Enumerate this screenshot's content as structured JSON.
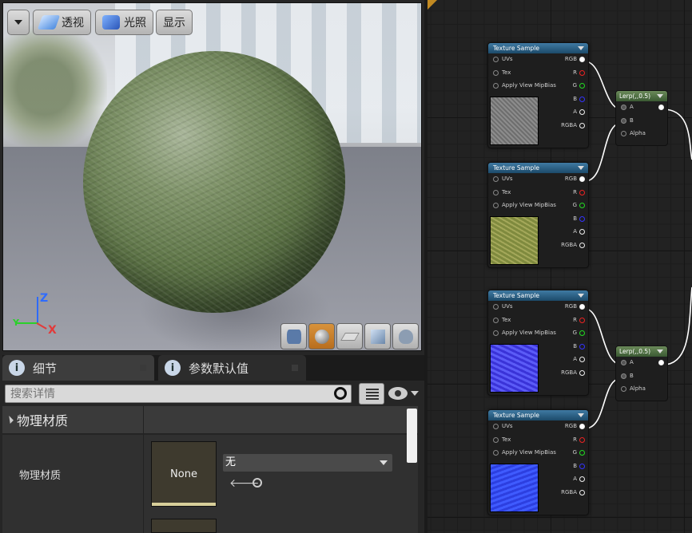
{
  "viewport": {
    "toolbar": {
      "perspective_label": "透视",
      "lighting_label": "光照",
      "show_label": "显示"
    },
    "axes": {
      "z": "Z",
      "y": "Y",
      "x": "X"
    },
    "preview_shapes": [
      "cylinder-icon",
      "sphere-icon",
      "plane-icon",
      "cube-icon",
      "teapot-icon"
    ],
    "active_shape": "sphere-icon"
  },
  "details": {
    "tabs": [
      {
        "label": "细节",
        "icon": "info-icon"
      },
      {
        "label": "参数默认值",
        "icon": "info-icon"
      }
    ],
    "search": {
      "placeholder": "搜索详情"
    },
    "section_title": "物理材质",
    "property_label": "物理材质",
    "thumbnail_text": "None",
    "combo_value": "无"
  },
  "graph": {
    "texture_nodes": [
      {
        "title": "Texture Sample",
        "inputs": [
          "UVs",
          "Tex",
          "Apply View MipBias"
        ],
        "outputs": [
          "RGB",
          "R",
          "G",
          "B",
          "A",
          "RGBA"
        ],
        "preview": "gray-texture"
      },
      {
        "title": "Texture Sample",
        "inputs": [
          "UVs",
          "Tex",
          "Apply View MipBias"
        ],
        "outputs": [
          "RGB",
          "R",
          "G",
          "B",
          "A",
          "RGBA"
        ],
        "preview": "grass-texture"
      },
      {
        "title": "Texture Sample",
        "inputs": [
          "UVs",
          "Tex",
          "Apply View MipBias"
        ],
        "outputs": [
          "RGB",
          "R",
          "G",
          "B",
          "A",
          "RGBA"
        ],
        "preview": "normal-map-texture"
      },
      {
        "title": "Texture Sample",
        "inputs": [
          "UVs",
          "Tex",
          "Apply View MipBias"
        ],
        "outputs": [
          "RGB",
          "R",
          "G",
          "B",
          "A",
          "RGBA"
        ],
        "preview": "normal-map-texture"
      }
    ],
    "lerp_nodes": [
      {
        "title": "Lerp(,,0.5)",
        "inputs": [
          "A",
          "B",
          "Alpha"
        ]
      },
      {
        "title": "Lerp(,,0.5)",
        "inputs": [
          "A",
          "B",
          "Alpha"
        ]
      }
    ],
    "colors": {
      "texture_header": "#2b6589",
      "lerp_header": "#4f7045",
      "pin_r": "#e22222",
      "pin_g": "#22dd22",
      "pin_b": "#3333ff"
    }
  }
}
